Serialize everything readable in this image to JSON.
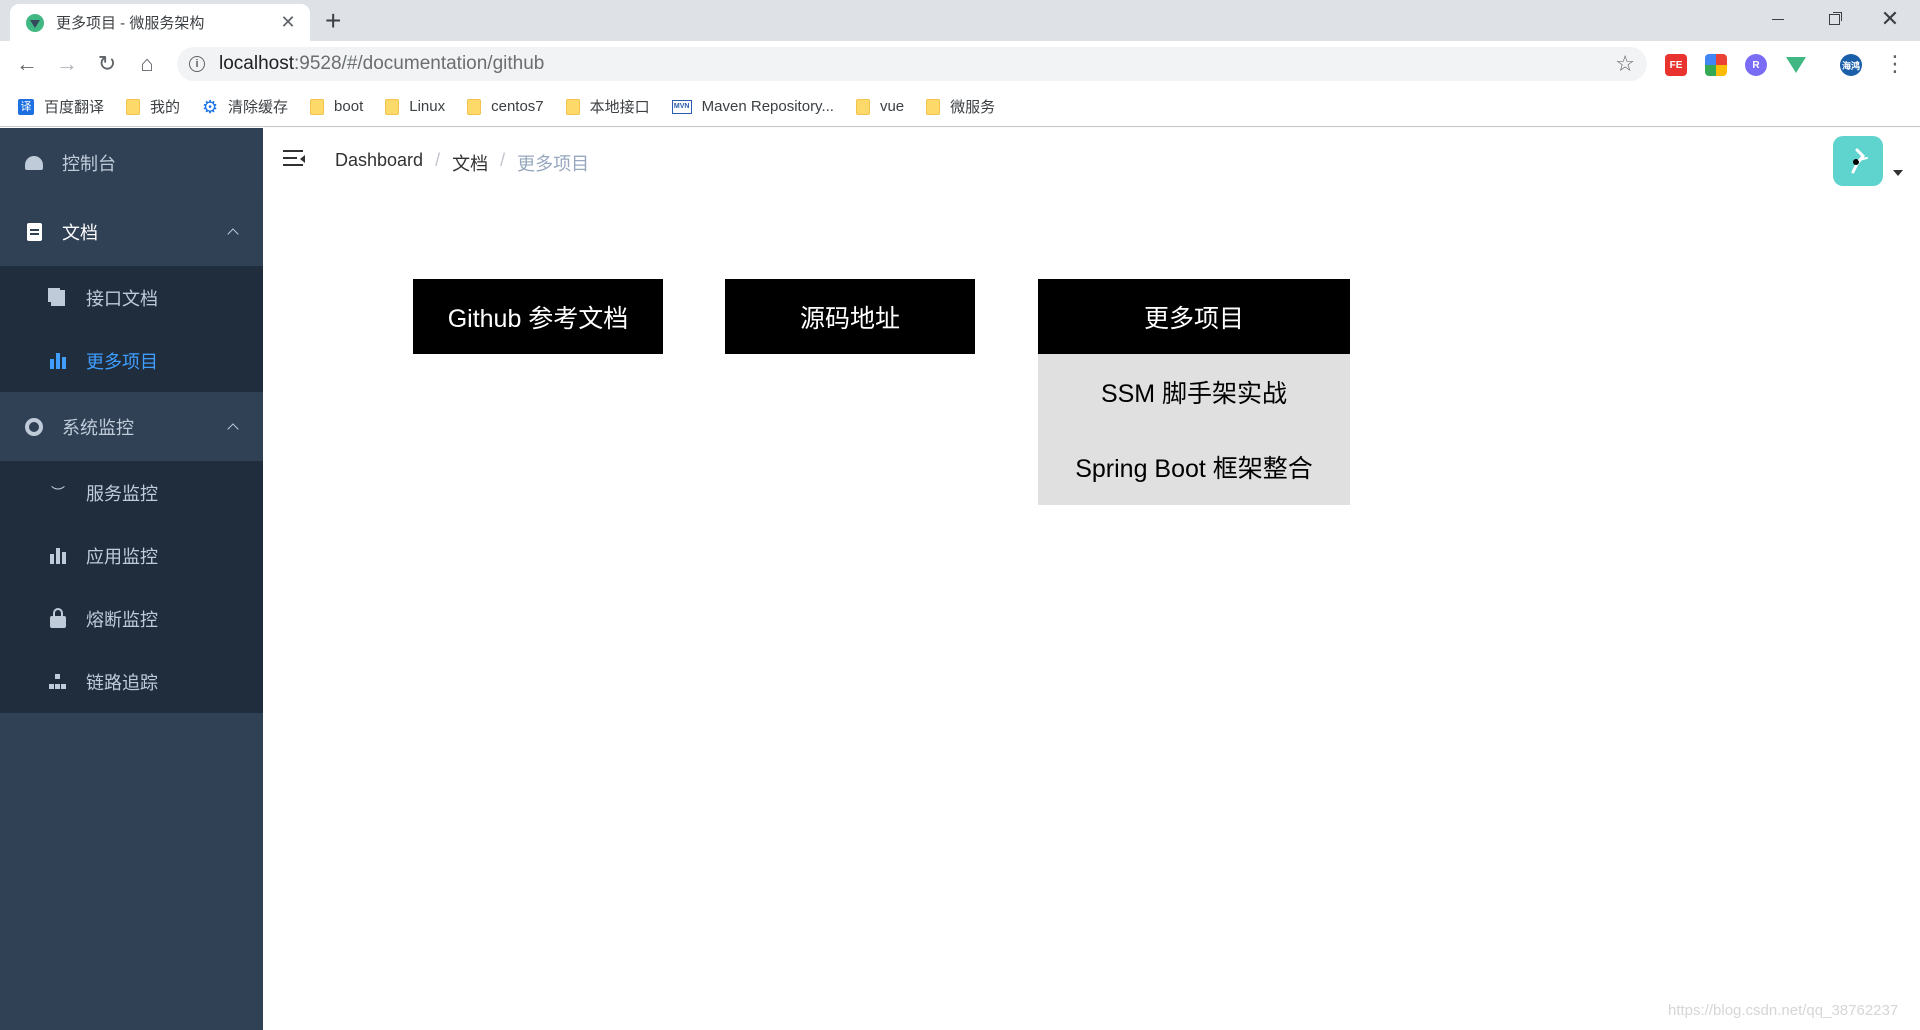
{
  "browser": {
    "tab_title": "更多项目 - 微服务架构",
    "tab_close": "✕",
    "new_tab": "+",
    "url_host": "localhost",
    "url_rest": ":9528/#/documentation/github",
    "star": "☆",
    "profile_label": "海鸿",
    "window_controls": {
      "close": "✕"
    }
  },
  "bookmarks": [
    {
      "label": "百度翻译",
      "icon": "translate-icon"
    },
    {
      "label": "我的",
      "icon": "folder-icon"
    },
    {
      "label": "清除缓存",
      "icon": "gear-icon"
    },
    {
      "label": "boot",
      "icon": "folder-icon"
    },
    {
      "label": "Linux",
      "icon": "folder-icon"
    },
    {
      "label": "centos7",
      "icon": "folder-icon"
    },
    {
      "label": "本地接口",
      "icon": "folder-icon"
    },
    {
      "label": "Maven Repository...",
      "icon": "mvn-icon"
    },
    {
      "label": "vue",
      "icon": "folder-icon"
    },
    {
      "label": "微服务",
      "icon": "folder-icon"
    }
  ],
  "translate_glyph": "译",
  "mvn_glyph": "MVN",
  "sidebar": {
    "dashboard": "控制台",
    "docs": "文档",
    "docs_children": [
      "接口文档",
      "更多项目"
    ],
    "monitor": "系统监控",
    "monitor_children": [
      "服务监控",
      "应用监控",
      "熔断监控",
      "链路追踪"
    ],
    "active_item": "更多项目"
  },
  "breadcrumb": [
    "Dashboard",
    "文档",
    "更多项目"
  ],
  "breadcrumb_sep": "/",
  "main": {
    "buttons": [
      "Github 参考文档",
      "源码地址",
      "更多项目"
    ],
    "dropdown_items": [
      "SSM 脚手架实战",
      "Spring Boot 框架整合"
    ]
  },
  "watermark": "https://blog.csdn.net/qq_38762237",
  "colors": {
    "sidebar_bg": "#304156",
    "submenu_bg": "#1f2d3d",
    "active": "#409eff",
    "avatar_bg": "#5fd3cd"
  }
}
